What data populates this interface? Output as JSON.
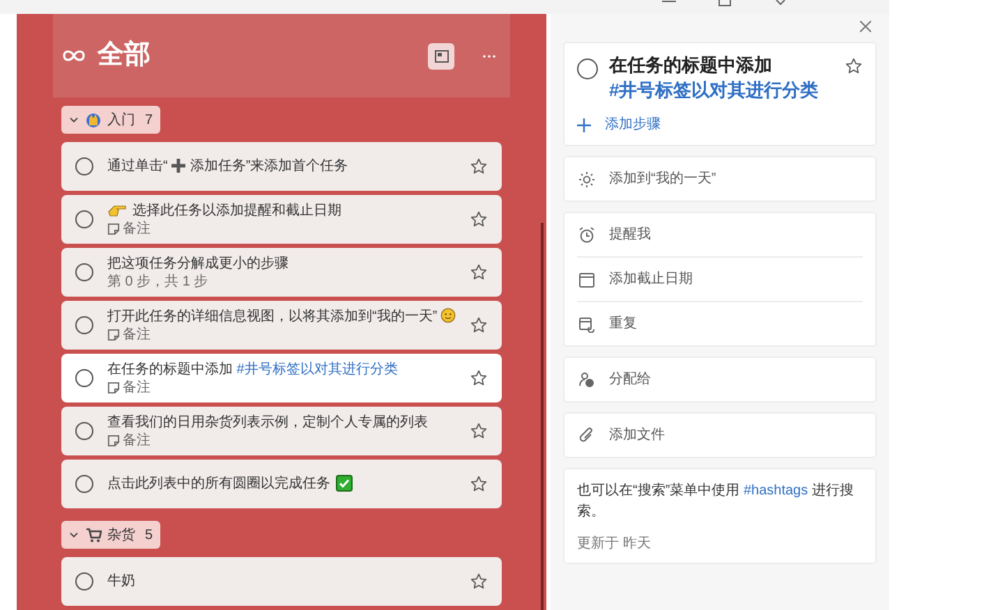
{
  "list": {
    "title": "全部"
  },
  "groups": [
    {
      "name": "入门",
      "count": "7",
      "expanded": true,
      "tasks": [
        {
          "title": "通过单击“",
          "title_after": "添加任务”来添加首个任务",
          "completed": false,
          "important": false,
          "selected": false
        },
        {
          "title": "选择此任务以添加提醒和截止日期",
          "note": "备注",
          "completed": false,
          "important": false,
          "selected": false
        },
        {
          "title": "把这项任务分解成更小的步骤",
          "steps": "第 0 步，共 1 步",
          "completed": false,
          "important": false,
          "selected": false
        },
        {
          "title": "打开此任务的详细信息视图，以将其添加到“我的一天”",
          "note": "备注",
          "completed": false,
          "important": false,
          "selected": false
        },
        {
          "title": "在任务的标题中添加 ",
          "hashtag": "#井号标签以对其进行分类",
          "note": "备注",
          "completed": false,
          "important": false,
          "selected": true
        },
        {
          "title": "查看我们的日用杂货列表示例，定制个人专属的列表",
          "note": "备注",
          "completed": false,
          "important": false,
          "selected": false
        },
        {
          "title": "点击此列表中的所有圆圈以完成任务",
          "completed": false,
          "important": false,
          "selected": false
        }
      ]
    },
    {
      "name": "杂货",
      "count": "5",
      "expanded": true,
      "tasks": [
        {
          "title": "牛奶",
          "completed": false,
          "important": false,
          "selected": false
        }
      ]
    }
  ],
  "detail": {
    "title": "在任务的标题中添加 ",
    "hashtag": "#井号标签以对其进行分类",
    "completed": false,
    "important": false,
    "add_step": "添加步骤",
    "my_day": "添加到“我的一天”",
    "dates": [
      "提醒我",
      "添加截止日期",
      "重复"
    ],
    "assign": "分配给",
    "attach": "添加文件",
    "note_before": "也可以在“搜索”菜单中使用 ",
    "note_hashtag": "#hashtags",
    "note_after": " 进行搜索。",
    "updated": "更新于 昨天"
  }
}
